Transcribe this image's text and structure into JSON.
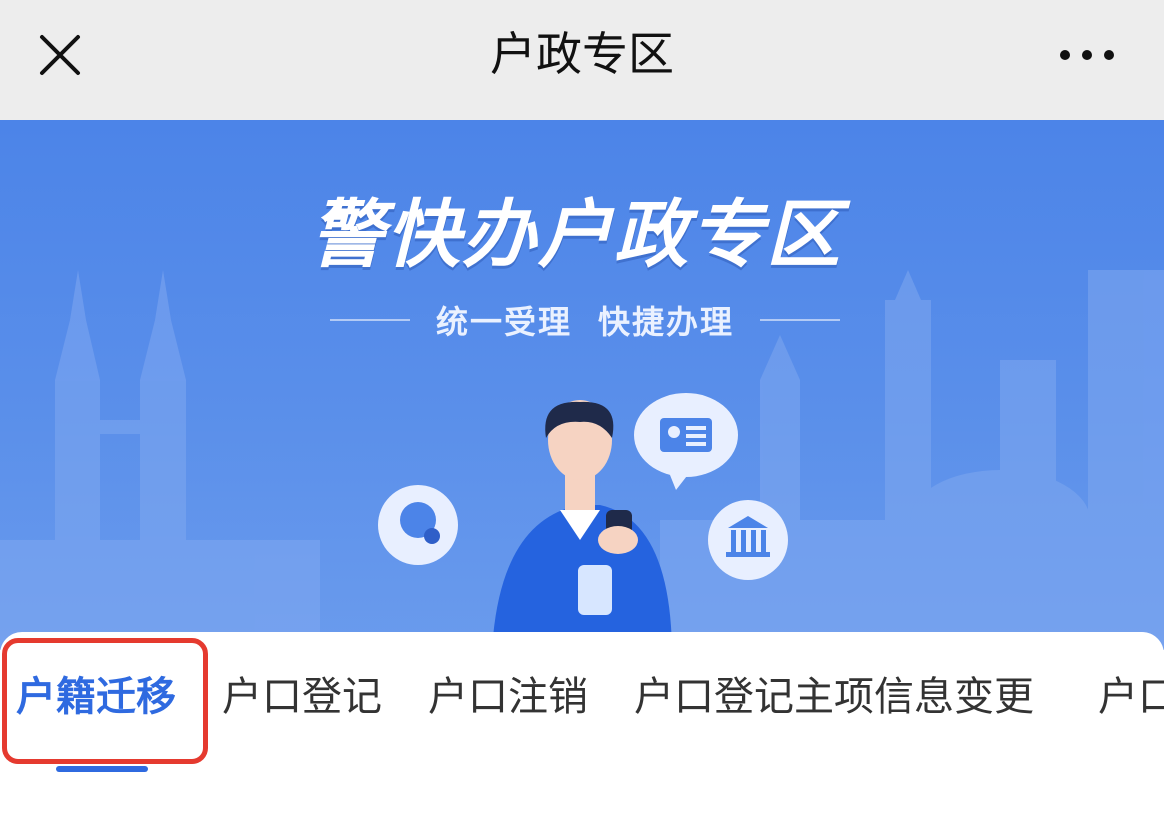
{
  "navbar": {
    "title": "户政专区",
    "close_icon": "close-icon",
    "more_icon": "more-icon"
  },
  "banner": {
    "title": "警快办户政专区",
    "subtitle_left": "统一受理",
    "subtitle_right": "快捷办理",
    "illustration": [
      "man-with-phone",
      "id-card-bubble",
      "bank-icon",
      "face-icon",
      "city-skyline"
    ]
  },
  "tabs": [
    {
      "label": "户籍迁移",
      "active": true
    },
    {
      "label": "户口登记",
      "active": false
    },
    {
      "label": "户口注销",
      "active": false
    },
    {
      "label": "户口登记主项信息变更",
      "active": false
    },
    {
      "label": "户口",
      "active": false
    }
  ],
  "colors": {
    "navbar_bg": "#ededed",
    "banner_blue": "#4c84e8",
    "accent": "#2f6ae0",
    "highlight_red": "#e53a2f"
  }
}
